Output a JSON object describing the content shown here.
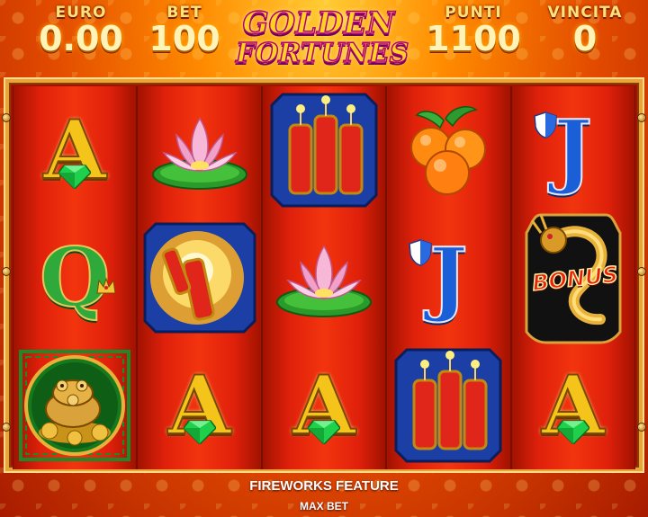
{
  "header": {
    "euro": {
      "label": "EURO",
      "value": "0.00"
    },
    "bet": {
      "label": "BET",
      "value": "100"
    },
    "punti": {
      "label": "PUNTI",
      "value": "1100"
    },
    "vincita": {
      "label": "VINCITA",
      "value": "0"
    },
    "logo": {
      "line1": "GOLDEN",
      "line2": "FORTUNES"
    }
  },
  "reels": [
    [
      "A",
      "Q",
      "toad"
    ],
    [
      "lotus",
      "fireworks-exploding",
      "A"
    ],
    [
      "fireworks",
      "lotus",
      "A"
    ],
    [
      "oranges",
      "J",
      "fireworks"
    ],
    [
      "J",
      "dragon-bonus",
      "A"
    ]
  ],
  "symbols": {
    "A": {
      "text": "A"
    },
    "Q": {
      "text": "Q"
    },
    "J": {
      "text": "J"
    },
    "bonus": {
      "text": "BONUS"
    }
  },
  "footer": {
    "feature": "FIREWORKS FEATURE",
    "max_bet": "MAX BET"
  },
  "colors": {
    "reel_red": "#f2340e",
    "gold": "#f5c41a",
    "blue": "#1a5fd8",
    "green": "#2faa3a"
  }
}
